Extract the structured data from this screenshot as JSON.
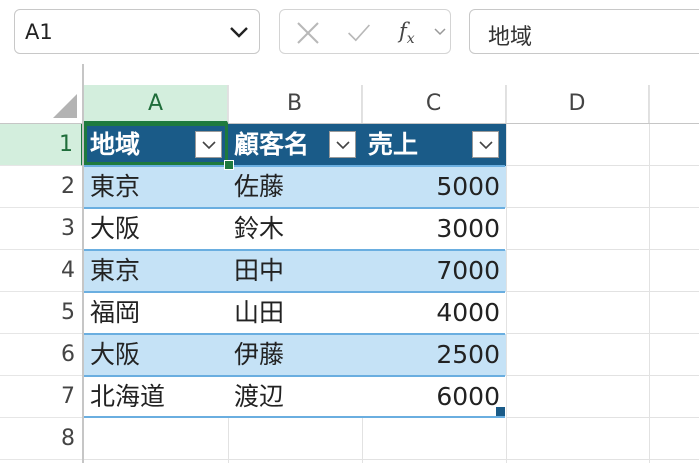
{
  "name_box": {
    "value": "A1"
  },
  "formula_bar": {
    "fx_label": "f",
    "fx_sub": "x",
    "content": "地域"
  },
  "columns": [
    "A",
    "B",
    "C",
    "D"
  ],
  "rows": [
    "1",
    "2",
    "3",
    "4",
    "5",
    "6",
    "7",
    "8"
  ],
  "table": {
    "headers": [
      "地域",
      "顧客名",
      "売上"
    ],
    "rows": [
      [
        "東京",
        "佐藤",
        "5000"
      ],
      [
        "大阪",
        "鈴木",
        "3000"
      ],
      [
        "東京",
        "田中",
        "7000"
      ],
      [
        "福岡",
        "山田",
        "4000"
      ],
      [
        "大阪",
        "伊藤",
        "2500"
      ],
      [
        "北海道",
        "渡辺",
        "6000"
      ]
    ]
  },
  "colors": {
    "header_bg": "#1a5b88",
    "band": "#c5e2f6",
    "selection": "#1e7a3e"
  }
}
